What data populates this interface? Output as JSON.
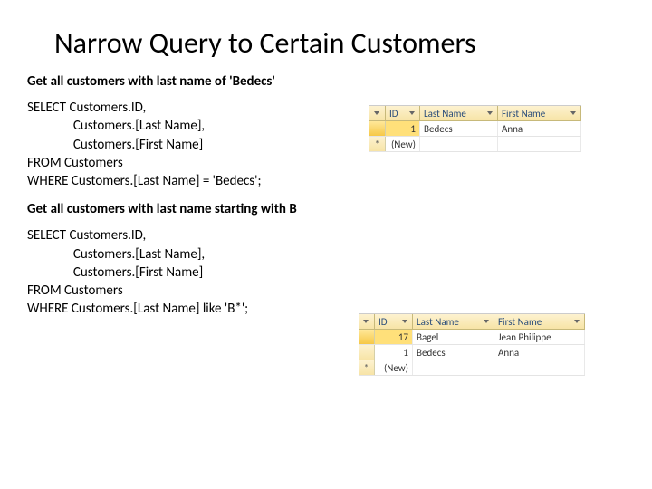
{
  "title": "Narrow Query to Certain Customers",
  "section1": {
    "heading": "Get all customers with last name of 'Bedecs'",
    "sql": "SELECT Customers.ID,\n               Customers.[Last Name],\n               Customers.[First Name]\nFROM Customers\nWHERE Customers.[Last Name] = 'Bedecs';"
  },
  "section2": {
    "heading": "Get all customers with last name starting with B",
    "sql": "SELECT Customers.ID,\n               Customers.[Last Name],\n               Customers.[First Name]\nFROM Customers\nWHERE Customers.[Last Name] like 'B*';"
  },
  "grid1": {
    "cols": {
      "id": "ID",
      "ln": "Last Name",
      "fn": "First Name"
    },
    "rows": [
      {
        "id": "1",
        "ln": "Bedecs",
        "fn": "Anna"
      }
    ],
    "newMarker": "*",
    "newPlaceholder": "(New)"
  },
  "grid2": {
    "cols": {
      "id": "ID",
      "ln": "Last Name",
      "fn": "First Name"
    },
    "rows": [
      {
        "id": "17",
        "ln": "Bagel",
        "fn": "Jean Philippe"
      },
      {
        "id": "1",
        "ln": "Bedecs",
        "fn": "Anna"
      }
    ],
    "newMarker": "*",
    "newPlaceholder": "(New)"
  }
}
